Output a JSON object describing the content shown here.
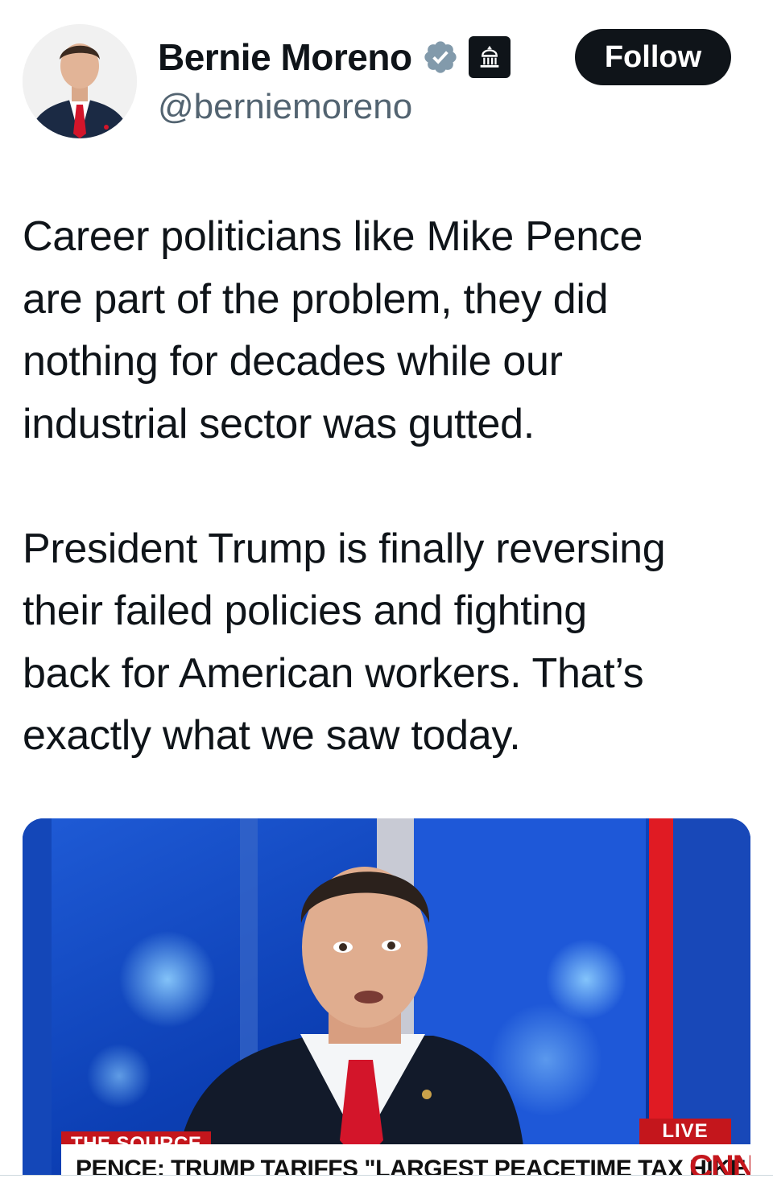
{
  "author": {
    "display_name": "Bernie Moreno",
    "handle": "@berniemoreno",
    "verified_icon": "verified-badge-icon",
    "affiliation_icon": "government-building-icon"
  },
  "follow_label": "Follow",
  "tweet": {
    "text": "Career politicians like Mike Pence\nare part of the problem, they did\nnothing for decades while our\nindustrial sector was gutted.\n\nPresident Trump is finally reversing\ntheir failed policies and fighting\nback for American workers. That’s\nexactly what we saw today."
  },
  "media": {
    "show_label": "THE SOURCE",
    "live_label": "LIVE",
    "chyron": "PENCE: TRUMP TARIFFS \"LARGEST PEACETIME TAX HIKE IN U.S. HISTORY\"",
    "network_logo": "CNN"
  },
  "colors": {
    "text": "#0f1419",
    "secondary": "#536471",
    "verified": "#829aab",
    "cnn_red": "#c4161c"
  }
}
